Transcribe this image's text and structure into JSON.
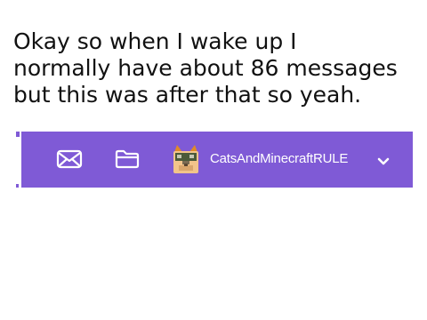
{
  "caption": {
    "lines": [
      "Okay so when I wake up I",
      "normally have about 86 messages",
      "but this was after that so yeah."
    ]
  },
  "menu_bar": {
    "background_color": "#7f5ad6",
    "icons": {
      "messages": "envelope-icon",
      "my_stuff": "folder-icon",
      "account_menu": "chevron-down-icon"
    },
    "username": "CatsAndMinecraftRULE"
  }
}
